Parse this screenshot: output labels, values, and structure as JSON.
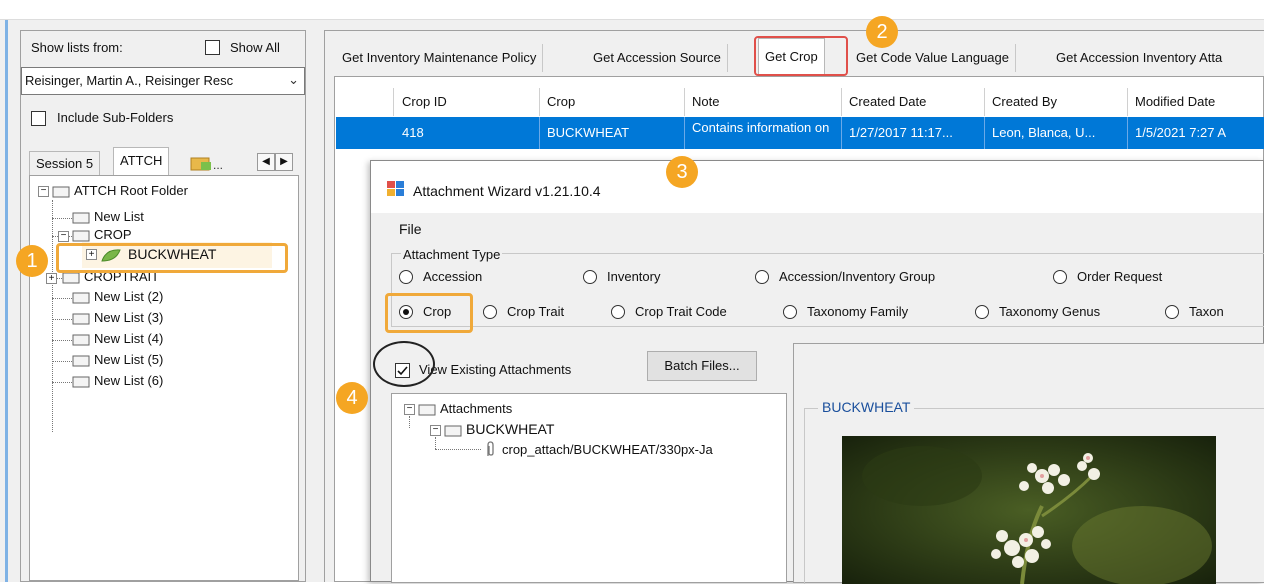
{
  "left_panel": {
    "show_lists_label": "Show lists from:",
    "show_all_label": "Show All",
    "owner_select": "Reisinger, Martin A., Reisinger Resc",
    "include_subfolders_label": "Include Sub-Folders",
    "tabs": [
      "Session 5",
      "ATTCH"
    ],
    "tree": {
      "root": "ATTCH Root Folder",
      "items": [
        "New List",
        "CROP",
        "BUCKWHEAT",
        "CROPTRAIT",
        "New List (2)",
        "New List (3)",
        "New List (4)",
        "New List (5)",
        "New List (6)"
      ]
    }
  },
  "top_tabs": [
    "Get Inventory Maintenance Policy",
    "Get Accession Source",
    "Get Crop",
    "Get Code Value Language",
    "Get Accession Inventory Atta"
  ],
  "grid": {
    "headers": [
      "Crop ID",
      "Crop",
      "Note",
      "Created Date",
      "Created By",
      "Modified Date"
    ],
    "row": [
      "418",
      "BUCKWHEAT",
      "Contains information on",
      "1/27/2017 11:17...",
      "Leon, Blanca, U...",
      "1/5/2021 7:27 A"
    ]
  },
  "wizard": {
    "title": "Attachment Wizard v1.21.10.4",
    "menu_file": "File",
    "attachment_type_label": "Attachment Type",
    "types_row1": [
      "Accession",
      "Inventory",
      "Accession/Inventory Group",
      "Order Request"
    ],
    "types_row2": [
      "Crop",
      "Crop Trait",
      "Crop Trait Code",
      "Taxonomy Family",
      "Taxonomy Genus",
      "Taxon"
    ],
    "view_existing_label": "View Existing Attachments",
    "batch_files_label": "Batch Files...",
    "attachments_root": "Attachments",
    "attachments_folder": "BUCKWHEAT",
    "attachment_file": "crop_attach/BUCKWHEAT/330px-Ja",
    "preview_label": "BUCKWHEAT"
  },
  "callouts": [
    "1",
    "2",
    "3",
    "4"
  ],
  "colors": {
    "selection": "#0078d7",
    "callout": "#f5a623",
    "highlight": "#f0a93a",
    "tab_highlight": "#e0504a"
  }
}
